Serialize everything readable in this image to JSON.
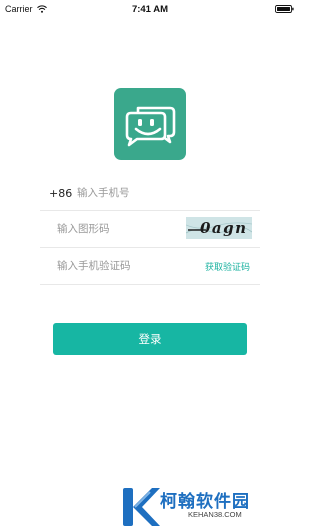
{
  "status_bar": {
    "carrier": "Carrier",
    "time": "7:41 AM"
  },
  "login_form": {
    "country_code": "+86",
    "phone_placeholder": "输入手机号",
    "captcha_placeholder": "输入图形码",
    "captcha_text": "0agn",
    "sms_placeholder": "输入手机验证码",
    "get_code_label": "获取验证码",
    "login_label": "登录"
  },
  "watermark": {
    "title": "柯翰软件园",
    "url": "KEHAN38.COM"
  },
  "colors": {
    "logo": "#3aa88c",
    "accent": "#17b6a3",
    "link": "#1db3a1",
    "watermark_blue": "#1e6fc0"
  },
  "icons": [
    "wifi-icon",
    "battery-icon",
    "chat-smile-icon"
  ]
}
